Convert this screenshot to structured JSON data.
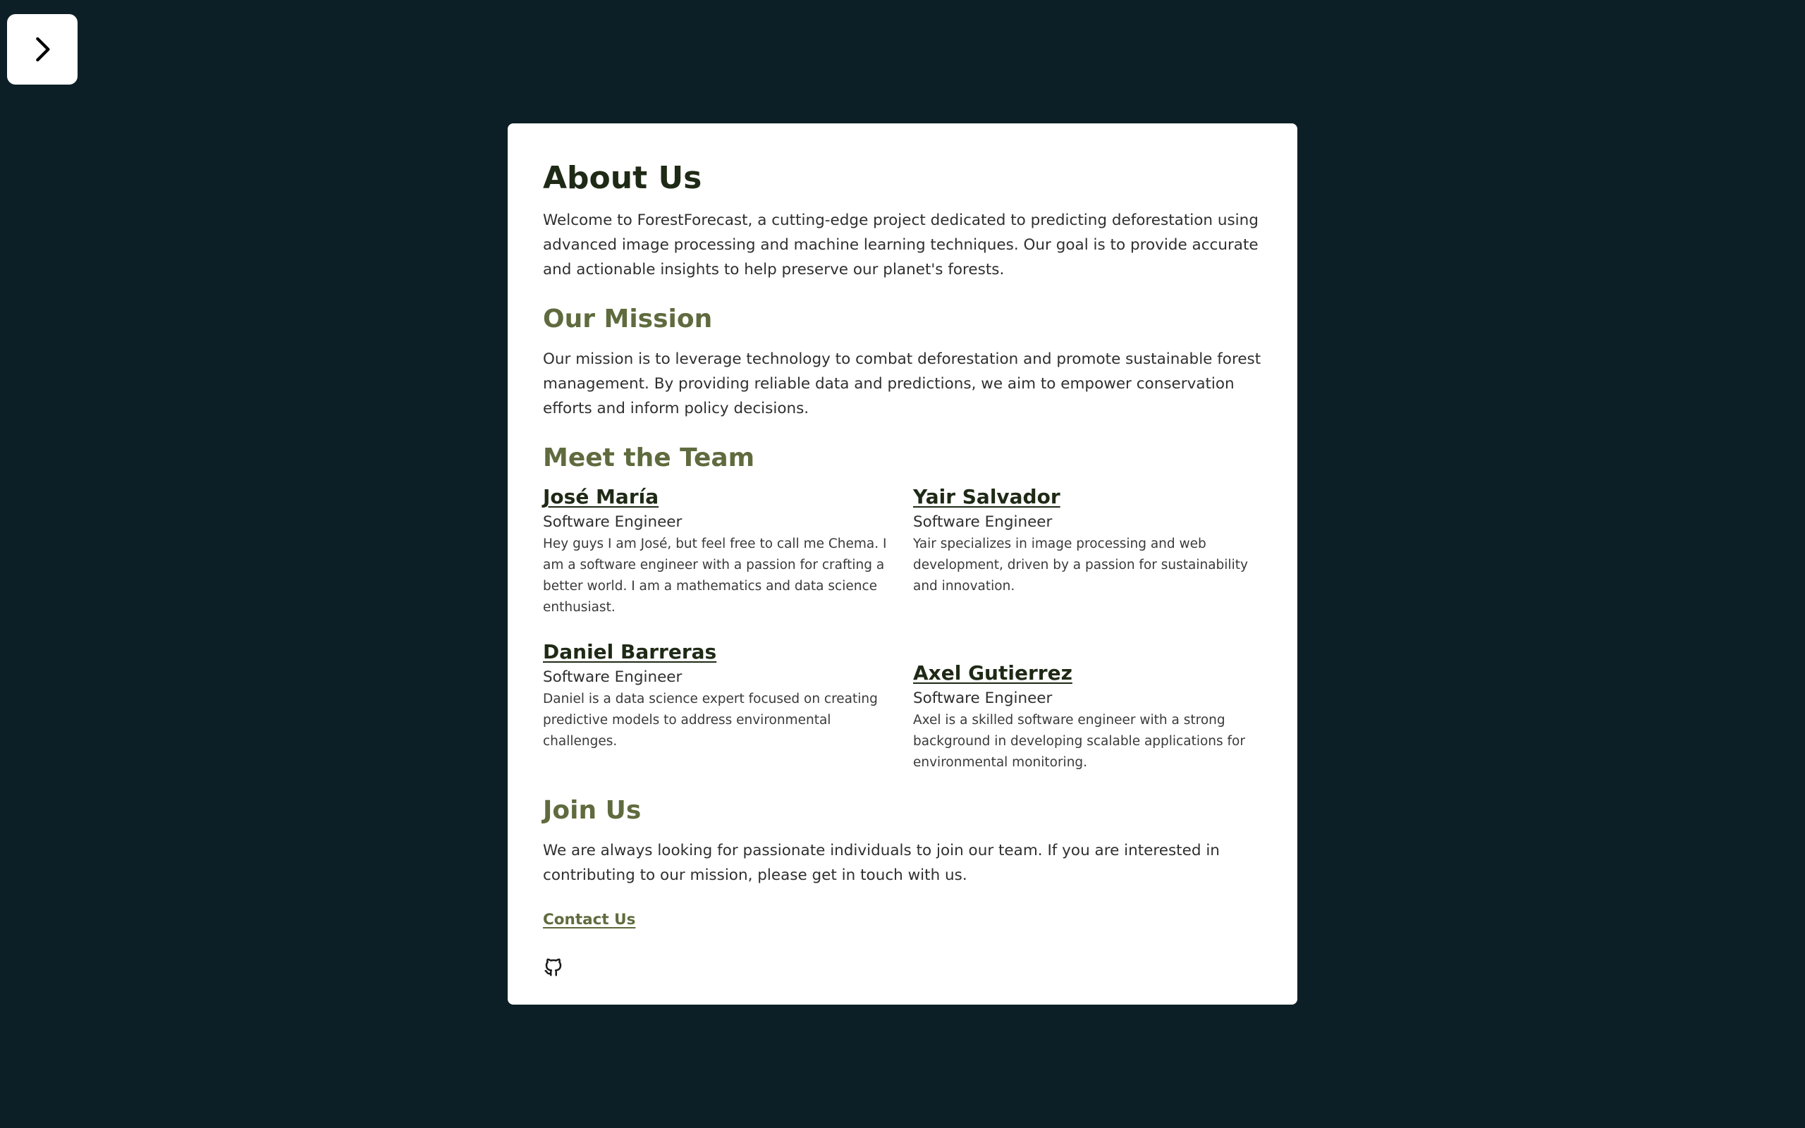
{
  "toggle": {
    "icon": "chevron-right-icon"
  },
  "about": {
    "title": "About Us",
    "intro": "Welcome to ForestForecast, a cutting-edge project dedicated to predicting deforestation using advanced image processing and machine learning techniques. Our goal is to provide accurate and actionable insights to help preserve our planet's forests."
  },
  "mission": {
    "title": "Our Mission",
    "text": "Our mission is to leverage technology to combat deforestation and promote sustainable forest management. By providing reliable data and predictions, we aim to empower conservation efforts and inform policy decisions."
  },
  "team": {
    "title": "Meet the Team",
    "members": [
      {
        "name": "José María",
        "role": "Software Engineer",
        "bio": "Hey guys I am José, but feel free to call me Chema. I am a software engineer with a passion for crafting a better world. I am a mathematics and data science enthusiast."
      },
      {
        "name": "Yair Salvador",
        "role": "Software Engineer",
        "bio": "Yair specializes in image processing and web development, driven by a passion for sustainability and innovation."
      },
      {
        "name": "Daniel Barreras",
        "role": "Software Engineer",
        "bio": "Daniel is a data science expert focused on creating predictive models to address environmental challenges."
      },
      {
        "name": "Axel Gutierrez",
        "role": "Software Engineer",
        "bio": "Axel is a skilled software engineer with a strong background in developing scalable applications for environmental monitoring."
      }
    ]
  },
  "join": {
    "title": "Join Us",
    "text": "We are always looking for passionate individuals to join our team. If you are interested in contributing to our mission, please get in touch with us.",
    "contact_label": "Contact Us"
  },
  "footer": {
    "icon": "github-icon"
  },
  "colors": {
    "background": "#0d1f26",
    "card": "#ffffff",
    "heading_dark": "#1f2a16",
    "heading_accent": "#5f6b3e"
  }
}
